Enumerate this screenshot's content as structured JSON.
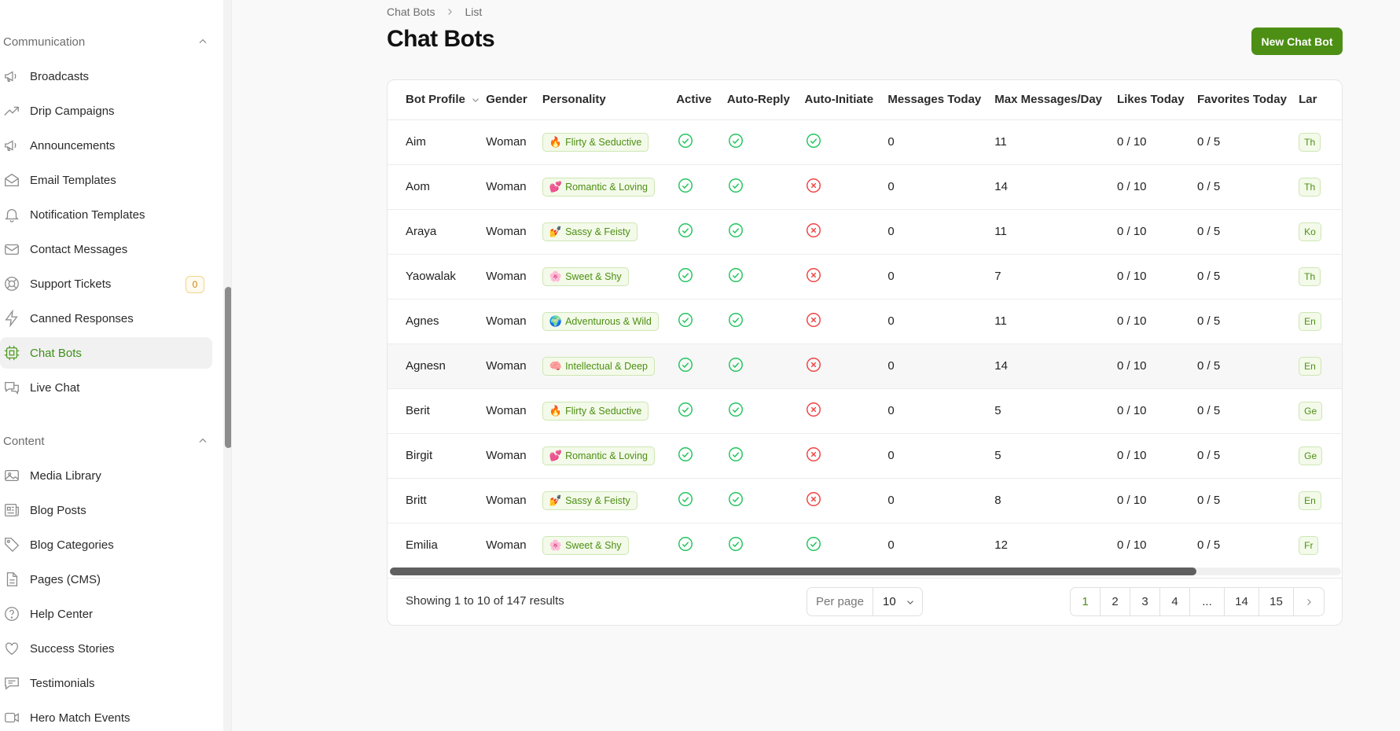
{
  "sidebar": {
    "groups": [
      {
        "label": "Communication"
      },
      {
        "label": "Content"
      }
    ],
    "items": [
      {
        "label": "Broadcasts",
        "icon": "megaphone-icon"
      },
      {
        "label": "Drip Campaigns",
        "icon": "trending-up-icon"
      },
      {
        "label": "Announcements",
        "icon": "megaphone-icon"
      },
      {
        "label": "Email Templates",
        "icon": "envelope-open-icon"
      },
      {
        "label": "Notification Templates",
        "icon": "bell-icon"
      },
      {
        "label": "Contact Messages",
        "icon": "envelope-icon"
      },
      {
        "label": "Support Tickets",
        "icon": "lifebuoy-icon",
        "badge": "0"
      },
      {
        "label": "Canned Responses",
        "icon": "bolt-icon"
      },
      {
        "label": "Chat Bots",
        "icon": "cpu-chip-icon",
        "active": true
      },
      {
        "label": "Live Chat",
        "icon": "chat-bubbles-icon"
      },
      {
        "label": "Media Library",
        "icon": "photo-icon"
      },
      {
        "label": "Blog Posts",
        "icon": "newspaper-icon"
      },
      {
        "label": "Blog Categories",
        "icon": "tag-icon"
      },
      {
        "label": "Pages (CMS)",
        "icon": "document-icon"
      },
      {
        "label": "Help Center",
        "icon": "question-circle-icon"
      },
      {
        "label": "Success Stories",
        "icon": "heart-icon"
      },
      {
        "label": "Testimonials",
        "icon": "chat-bubble-icon"
      },
      {
        "label": "Hero Match Events",
        "icon": "video-camera-icon"
      }
    ]
  },
  "breadcrumb": {
    "parent": "Chat Bots",
    "current": "List"
  },
  "page": {
    "title": "Chat Bots",
    "new_button": "New Chat Bot"
  },
  "table": {
    "columns": [
      "Bot Profile",
      "Gender",
      "Personality",
      "Active",
      "Auto-Reply",
      "Auto-Initiate",
      "Messages Today",
      "Max Messages/Day",
      "Likes Today",
      "Favorites Today",
      "Lar"
    ],
    "rows": [
      {
        "name": "Aim",
        "gender": "Woman",
        "personality_emoji": "🔥",
        "personality": "Flirty & Seductive",
        "active": true,
        "auto_reply": true,
        "auto_initiate": true,
        "messages_today": "0",
        "max_messages": "11",
        "likes": "0 / 10",
        "favorites": "0 / 5",
        "lang": "Th"
      },
      {
        "name": "Aom",
        "gender": "Woman",
        "personality_emoji": "💕",
        "personality": "Romantic & Loving",
        "active": true,
        "auto_reply": true,
        "auto_initiate": false,
        "messages_today": "0",
        "max_messages": "14",
        "likes": "0 / 10",
        "favorites": "0 / 5",
        "lang": "Th"
      },
      {
        "name": "Araya",
        "gender": "Woman",
        "personality_emoji": "💅",
        "personality": "Sassy & Feisty",
        "active": true,
        "auto_reply": true,
        "auto_initiate": false,
        "messages_today": "0",
        "max_messages": "11",
        "likes": "0 / 10",
        "favorites": "0 / 5",
        "lang": "Ko"
      },
      {
        "name": "Yaowalak",
        "gender": "Woman",
        "personality_emoji": "🌸",
        "personality": "Sweet & Shy",
        "active": true,
        "auto_reply": true,
        "auto_initiate": false,
        "messages_today": "0",
        "max_messages": "7",
        "likes": "0 / 10",
        "favorites": "0 / 5",
        "lang": "Th"
      },
      {
        "name": "Agnes",
        "gender": "Woman",
        "personality_emoji": "🌍",
        "personality": "Adventurous & Wild",
        "active": true,
        "auto_reply": true,
        "auto_initiate": false,
        "messages_today": "0",
        "max_messages": "11",
        "likes": "0 / 10",
        "favorites": "0 / 5",
        "lang": "En"
      },
      {
        "name": "Agnesn",
        "gender": "Woman",
        "personality_emoji": "🧠",
        "personality": "Intellectual & Deep",
        "active": true,
        "auto_reply": true,
        "auto_initiate": false,
        "messages_today": "0",
        "max_messages": "14",
        "likes": "0 / 10",
        "favorites": "0 / 5",
        "lang": "En"
      },
      {
        "name": "Berit",
        "gender": "Woman",
        "personality_emoji": "🔥",
        "personality": "Flirty & Seductive",
        "active": true,
        "auto_reply": true,
        "auto_initiate": false,
        "messages_today": "0",
        "max_messages": "5",
        "likes": "0 / 10",
        "favorites": "0 / 5",
        "lang": "Ge"
      },
      {
        "name": "Birgit",
        "gender": "Woman",
        "personality_emoji": "💕",
        "personality": "Romantic & Loving",
        "active": true,
        "auto_reply": true,
        "auto_initiate": false,
        "messages_today": "0",
        "max_messages": "5",
        "likes": "0 / 10",
        "favorites": "0 / 5",
        "lang": "Ge"
      },
      {
        "name": "Britt",
        "gender": "Woman",
        "personality_emoji": "💅",
        "personality": "Sassy & Feisty",
        "active": true,
        "auto_reply": true,
        "auto_initiate": false,
        "messages_today": "0",
        "max_messages": "8",
        "likes": "0 / 10",
        "favorites": "0 / 5",
        "lang": "En"
      },
      {
        "name": "Emilia",
        "gender": "Woman",
        "personality_emoji": "🌸",
        "personality": "Sweet & Shy",
        "active": true,
        "auto_reply": true,
        "auto_initiate": true,
        "messages_today": "0",
        "max_messages": "12",
        "likes": "0 / 10",
        "favorites": "0 / 5",
        "lang": "Fr"
      }
    ]
  },
  "footer": {
    "results_text": "Showing 1 to 10 of 147 results",
    "per_page_label": "Per page",
    "per_page_value": "10",
    "pages": [
      "1",
      "2",
      "3",
      "4",
      "...",
      "14",
      "15"
    ],
    "current_page": "1"
  },
  "colors": {
    "accent": "#4d8f14",
    "success": "#22c55e",
    "danger": "#ef4444",
    "badge": "#c48a10"
  }
}
